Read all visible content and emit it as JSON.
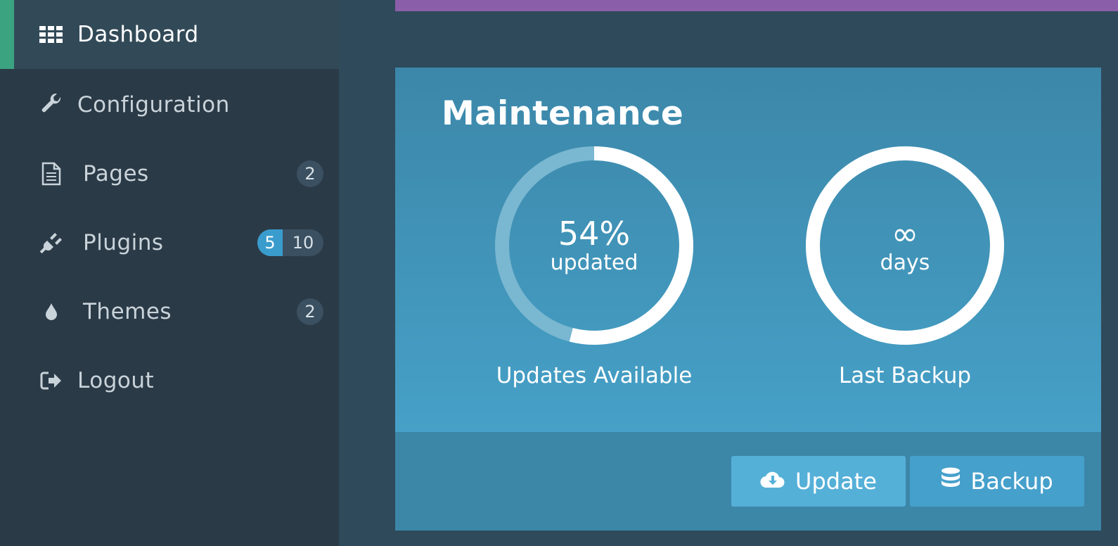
{
  "sidebar": {
    "items": [
      {
        "label": "Dashboard",
        "icon": "grid-icon"
      },
      {
        "label": "Configuration",
        "icon": "wrench-icon"
      },
      {
        "label": "Pages",
        "icon": "document-icon",
        "badge": "2"
      },
      {
        "label": "Plugins",
        "icon": "plug-icon",
        "badge_updates": "5",
        "badge_total": "10"
      },
      {
        "label": "Themes",
        "icon": "droplet-icon",
        "badge": "2"
      },
      {
        "label": "Logout",
        "icon": "logout-icon"
      }
    ],
    "accent_color": "#3ca381"
  },
  "panel": {
    "title": "Maintenance",
    "updates": {
      "value": "54%",
      "unit": "updated",
      "caption": "Updates Available",
      "fraction": 0.54
    },
    "backup": {
      "value": "∞",
      "unit": "days",
      "caption": "Last Backup",
      "fraction": 1.0
    },
    "buttons": {
      "update": "Update",
      "backup": "Backup"
    }
  },
  "colors": {
    "topbar": "#8a5ea8",
    "panel": "#3c86a8",
    "badge_highlight": "#3a9ccd"
  }
}
